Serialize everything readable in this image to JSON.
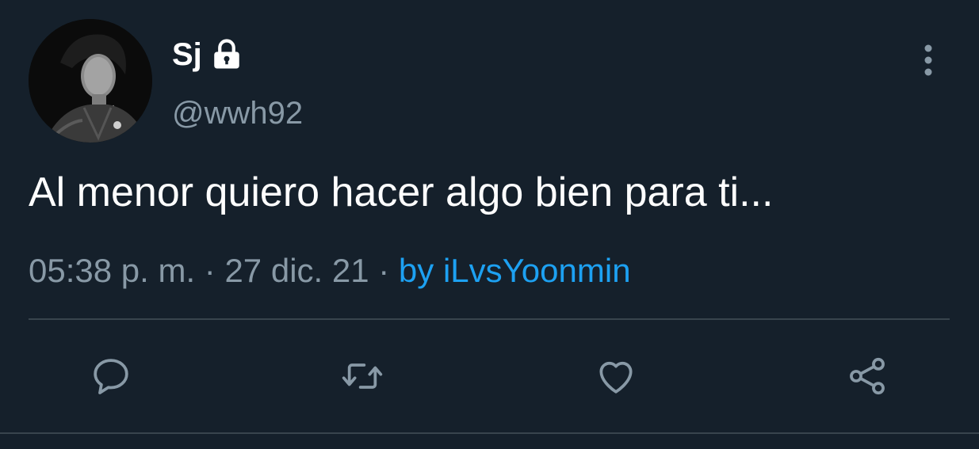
{
  "user": {
    "display_name": "Sj",
    "handle": "@wwh92",
    "protected_icon": "lock-icon"
  },
  "tweet": {
    "text": "Al menor quiero hacer algo bien para ti...",
    "time": "05:38 p. m.",
    "date": "27 dic. 21",
    "separator": "·",
    "source": "by iLvsYoonmin"
  },
  "actions": [
    {
      "icon": "reply-icon"
    },
    {
      "icon": "retweet-icon"
    },
    {
      "icon": "like-icon"
    },
    {
      "icon": "share-icon"
    }
  ],
  "colors": {
    "background": "#15202b",
    "text": "#ffffff",
    "secondary": "#8899a6",
    "accent": "#1da1f2",
    "divider": "#38444d"
  }
}
